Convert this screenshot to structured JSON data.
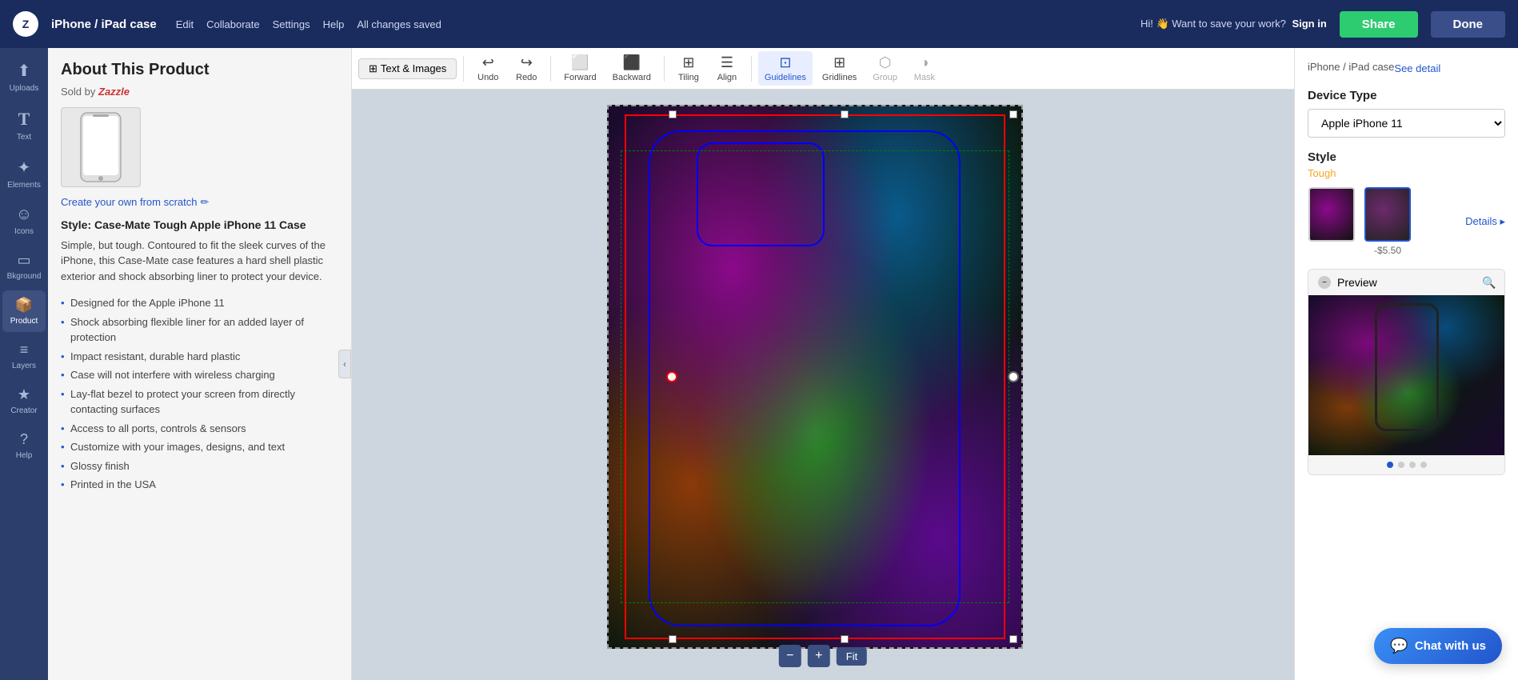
{
  "app": {
    "logo": "Z",
    "title": "iPhone / iPad case",
    "all_changes_saved": "All changes saved"
  },
  "nav": {
    "menu_items": [
      "Edit",
      "Collaborate",
      "Settings",
      "Help"
    ],
    "save_prompt": "Hi! 👋 Want to save your work?",
    "sign_in": "Sign in",
    "share_btn": "Share",
    "done_btn": "Done"
  },
  "sidebar": {
    "items": [
      {
        "id": "uploads",
        "label": "Uploads",
        "icon": "⬆"
      },
      {
        "id": "text",
        "label": "Text",
        "icon": "T"
      },
      {
        "id": "elements",
        "label": "Elements",
        "icon": "✦"
      },
      {
        "id": "icons",
        "label": "Icons",
        "icon": "☺"
      },
      {
        "id": "background",
        "label": "Bkground",
        "icon": "□"
      },
      {
        "id": "product",
        "label": "Product",
        "icon": "📦"
      },
      {
        "id": "layers",
        "label": "Layers",
        "icon": "≡"
      },
      {
        "id": "creator",
        "label": "Creator",
        "icon": "★"
      },
      {
        "id": "help",
        "label": "Help",
        "icon": "?"
      }
    ]
  },
  "product_panel": {
    "title": "About This Product",
    "sold_by": "Sold by",
    "sold_by_brand": "Zazzle",
    "create_own": "Create your own from scratch",
    "style_title": "Style: Case-Mate Tough Apple iPhone 11 Case",
    "description": "Simple, but tough. Contoured to fit the sleek curves of the iPhone, this Case-Mate case features a hard shell plastic exterior and shock absorbing liner to protect your device.",
    "features": [
      "Designed for the Apple iPhone 11",
      "Shock absorbing flexible liner for an added layer of protection",
      "Impact resistant, durable hard plastic",
      "Case will not interfere with wireless charging",
      "Lay-flat bezel to protect your screen from directly contacting surfaces",
      "Access to all ports, controls & sensors",
      "Customize with your images, designs, and text",
      "Glossy finish",
      "Printed in the USA"
    ]
  },
  "toolbar": {
    "undo": "Undo",
    "redo": "Redo",
    "forward": "Forward",
    "backward": "Backward",
    "tiling": "Tiling",
    "align": "Align",
    "guidelines": "Guidelines",
    "gridlines": "Gridlines",
    "group": "Group",
    "mask": "Mask",
    "text_images_tab": "Text & Images"
  },
  "canvas": {
    "zoom_minus": "−",
    "zoom_plus": "+",
    "zoom_fit": "Fit"
  },
  "right_panel": {
    "breadcrumb": "iPhone / iPad case",
    "see_detail": "See detail",
    "device_type_label": "Device Type",
    "device_type_value": "Apple iPhone 11",
    "style_label": "Style",
    "style_value": "Tough",
    "price_1": "",
    "price_2": "-$5.50",
    "details_link": "Details ▸",
    "preview_title": "Preview",
    "preview_dots": [
      true,
      false,
      false,
      false
    ]
  },
  "chat": {
    "button_label": "Chat with us"
  }
}
